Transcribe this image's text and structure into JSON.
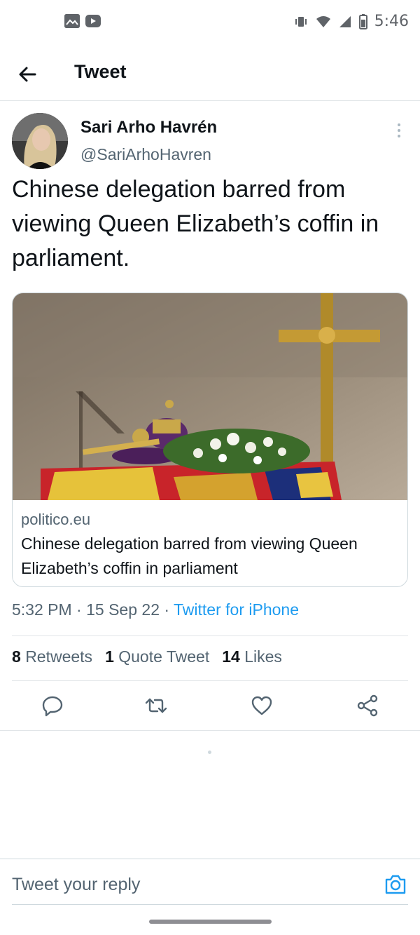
{
  "status_bar": {
    "time": "5:46",
    "left_icons": [
      "gallery-icon",
      "youtube-icon"
    ],
    "right_icons": [
      "vibrate-icon",
      "wifi-icon",
      "signal-icon",
      "battery-icon"
    ]
  },
  "header": {
    "title": "Tweet",
    "back_icon": "arrow-left-icon"
  },
  "tweet": {
    "author_name": "Sari Arho Havrén",
    "author_handle": "@SariArhoHavren",
    "text": "Chinese delegation barred from viewing Queen Elizabeth’s coffin in parliament.",
    "card": {
      "domain": "politico.eu",
      "title": "Chinese delegation barred from viewing Queen Elizabeth’s coffin in parliament"
    },
    "meta": {
      "time": "5:32 PM",
      "date": "15 Sep 22",
      "source": "Twitter for iPhone"
    },
    "stats": {
      "retweets_count": "8",
      "retweets_label": "Retweets",
      "quotes_count": "1",
      "quotes_label": "Quote Tweet",
      "likes_count": "14",
      "likes_label": "Likes"
    },
    "actions": [
      "reply-icon",
      "retweet-icon",
      "like-icon",
      "share-icon"
    ]
  },
  "reply": {
    "placeholder": "Tweet your reply",
    "camera_icon": "camera-icon"
  },
  "colors": {
    "accent": "#1d9bf0",
    "text_primary": "#0f1419",
    "text_secondary": "#536471",
    "border": "#cfd9de"
  }
}
